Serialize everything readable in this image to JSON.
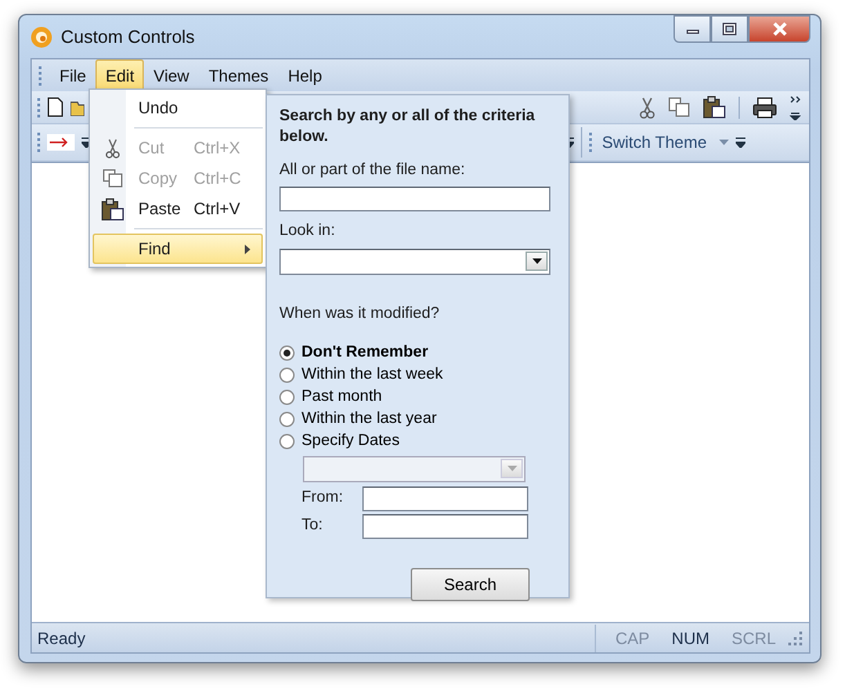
{
  "window": {
    "title": "Custom Controls"
  },
  "menu_bar": [
    {
      "label": "File",
      "selected": false
    },
    {
      "label": "Edit",
      "selected": true
    },
    {
      "label": "View",
      "selected": false
    },
    {
      "label": "Themes",
      "selected": false
    },
    {
      "label": "Help",
      "selected": false
    }
  ],
  "edit_menu": [
    {
      "kind": "command",
      "label": "Undo",
      "disabled": false,
      "selected": false
    },
    {
      "kind": "separator"
    },
    {
      "kind": "cut",
      "label": "Cut",
      "shortcut": "Ctrl+X",
      "disabled": true,
      "selected": false
    },
    {
      "kind": "copy",
      "label": "Copy",
      "shortcut": "Ctrl+C",
      "disabled": true,
      "selected": false
    },
    {
      "kind": "paste",
      "label": "Paste",
      "shortcut": "Ctrl+V",
      "disabled": false,
      "selected": false
    },
    {
      "kind": "separator"
    },
    {
      "kind": "submenu",
      "label": "Find",
      "disabled": false,
      "selected": true
    }
  ],
  "toolbar": {
    "switch_theme": "Switch Theme"
  },
  "find_panel": {
    "heading": "Search by any or all of the criteria below.",
    "file_name_label": "All or part of the file name:",
    "look_in_label": "Look in:",
    "modified_label": "When was it modified?",
    "options": [
      {
        "label": "Don't Remember",
        "selected": true
      },
      {
        "label": "Within the last week",
        "selected": false
      },
      {
        "label": "Past month",
        "selected": false
      },
      {
        "label": "Within the last year",
        "selected": false
      },
      {
        "label": "Specify Dates",
        "selected": false
      }
    ],
    "dates_dropdown": {
      "disabled": true
    },
    "from_label": "From:",
    "to_label": "To:",
    "search_button": "Search"
  },
  "status_bar": {
    "text": "Ready",
    "indicators": [
      {
        "label": "CAP",
        "on": false
      },
      {
        "label": "NUM",
        "on": true
      },
      {
        "label": "SCRL",
        "on": false
      }
    ]
  }
}
